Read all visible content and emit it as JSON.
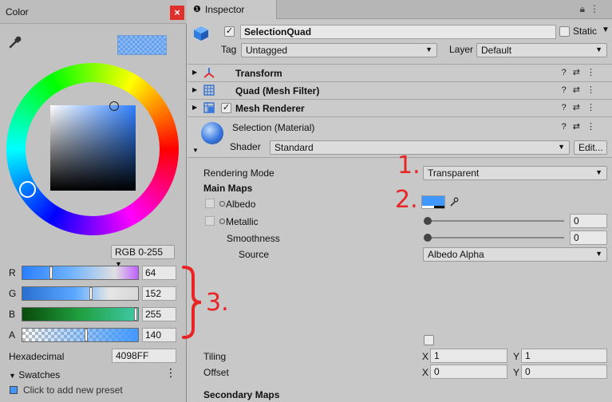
{
  "color_window": {
    "title": "Color",
    "close_glyph": "×",
    "mode": "RGB 0-255",
    "channels": [
      {
        "label": "R",
        "value": "64"
      },
      {
        "label": "G",
        "value": "152"
      },
      {
        "label": "B",
        "value": "255"
      },
      {
        "label": "A",
        "value": "140"
      }
    ],
    "hex_label": "Hexadecimal",
    "hex_value": "4098FF",
    "swatches_label": "Swatches",
    "swatches_menu": "⋮",
    "swatches_hint": "Click to add new preset",
    "colors": {
      "selected": "#4098ff"
    }
  },
  "inspector": {
    "tab_label": "Inspector",
    "object_name": "SelectionQuad",
    "static_label": "Static",
    "tag_label": "Tag",
    "tag_value": "Untagged",
    "layer_label": "Layer",
    "layer_value": "Default",
    "components": [
      {
        "name": "Transform"
      },
      {
        "name": "Quad (Mesh Filter)"
      },
      {
        "name": "Mesh Renderer"
      }
    ],
    "material": {
      "name": "Selection (Material)",
      "shader_label": "Shader",
      "shader_value": "Standard",
      "edit_label": "Edit..."
    },
    "properties": {
      "rendering_mode_label": "Rendering Mode",
      "rendering_mode_value": "Transparent",
      "main_maps_label": "Main Maps",
      "albedo_label": "Albedo",
      "metallic_label": "Metallic",
      "metallic_value": "0",
      "smoothness_label": "Smoothness",
      "smoothness_value": "0",
      "source_label": "Source",
      "source_value": "Albedo Alpha",
      "tiling_label": "Tiling",
      "tiling_x_label": "X",
      "tiling_x": "1",
      "tiling_y_label": "Y",
      "tiling_y": "1",
      "offset_label": "Offset",
      "offset_x_label": "X",
      "offset_x": "0",
      "offset_y_label": "Y",
      "offset_y": "0",
      "secondary_maps_label": "Secondary Maps"
    }
  },
  "annotations": {
    "one": "1.",
    "two": "2.",
    "three": "3."
  }
}
